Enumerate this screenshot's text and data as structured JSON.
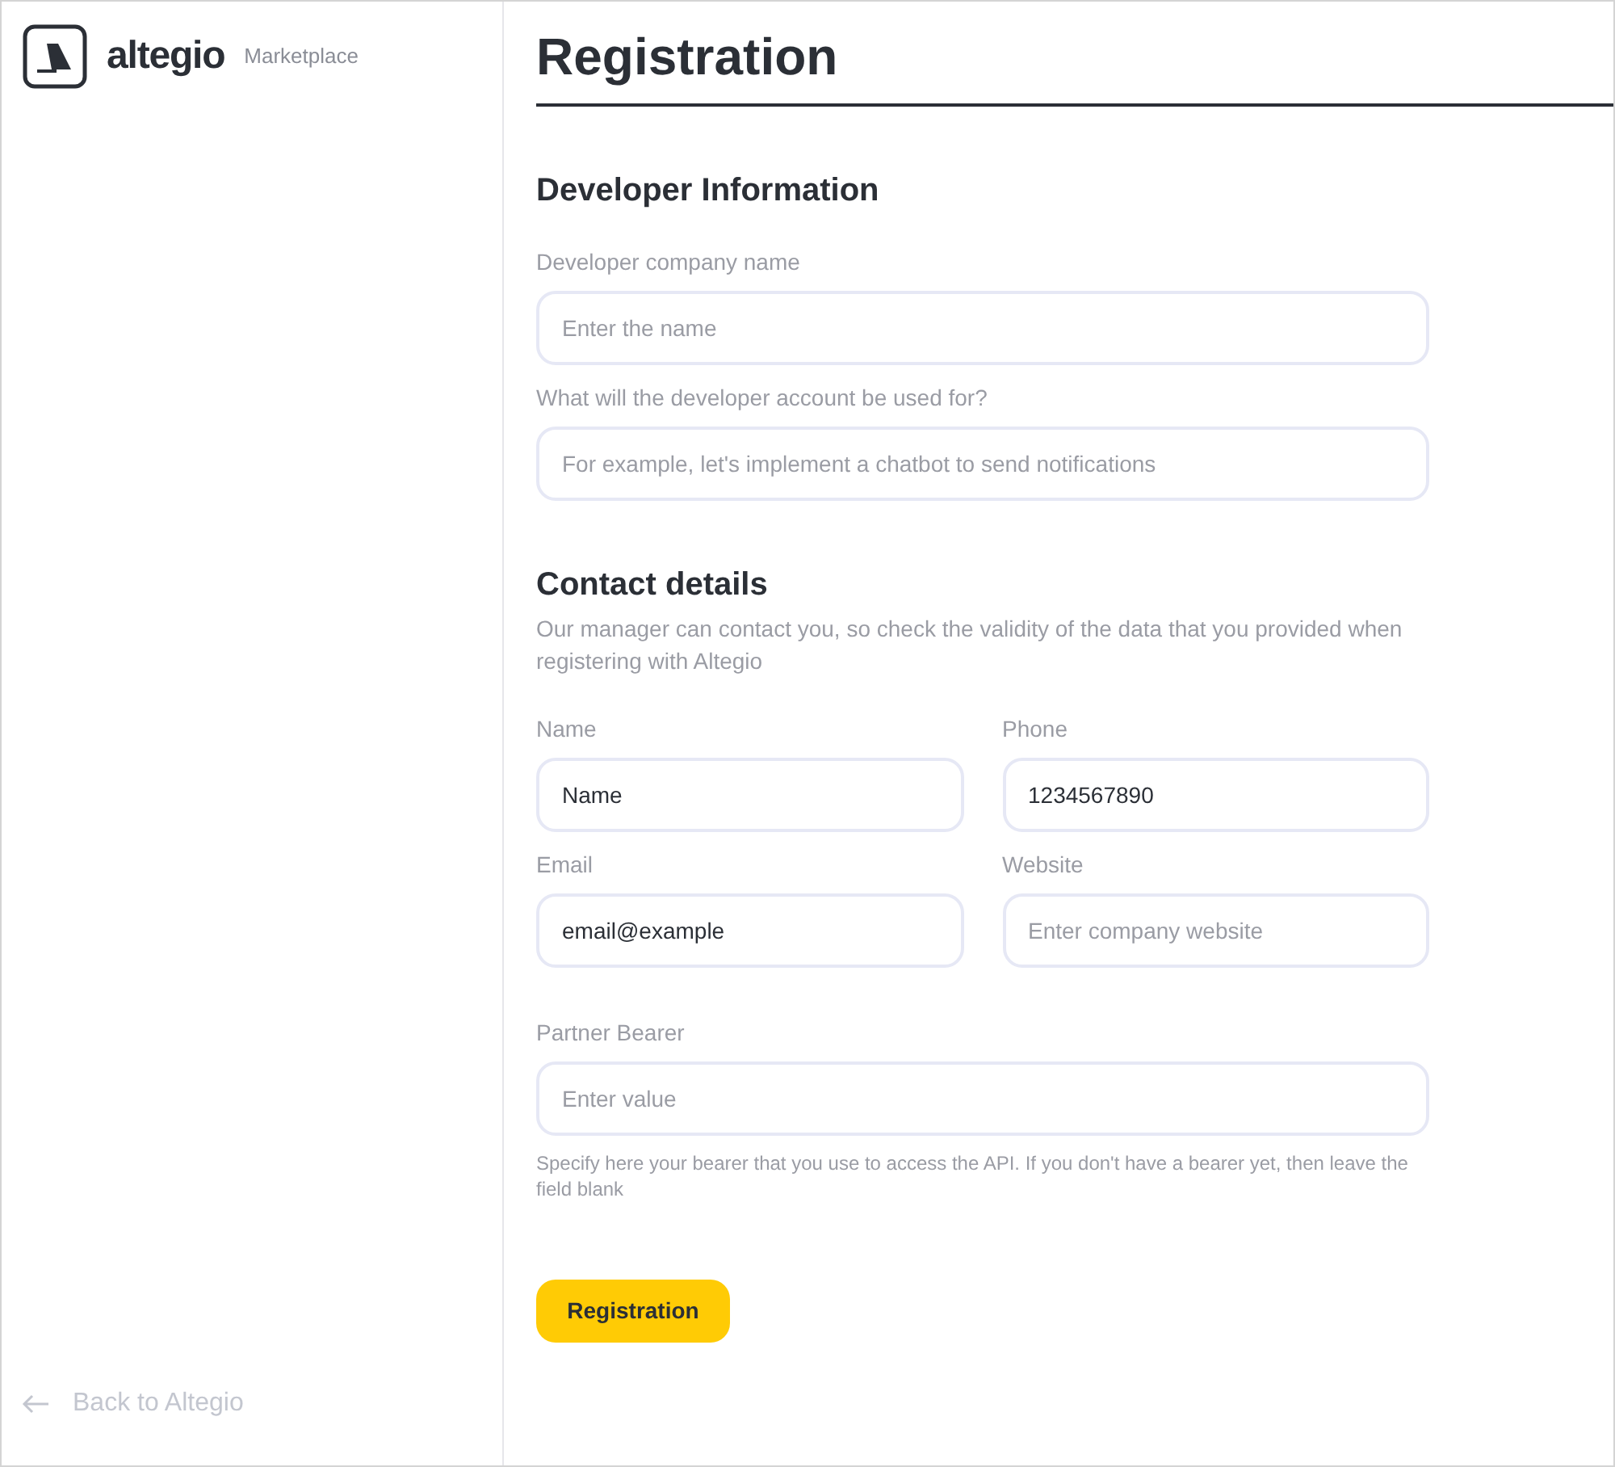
{
  "sidebar": {
    "brand": "altegio",
    "subtitle": "Marketplace",
    "back_link": "Back to Altegio"
  },
  "page_title": "Registration",
  "sections": [
    {
      "heading": "Developer Information",
      "rows": [
        [
          {
            "label": "Developer company name",
            "placeholder": "Enter the name"
          }
        ],
        [
          {
            "label": "What will the developer account be used for?",
            "placeholder": "For example, let's implement a chatbot to send notifications"
          }
        ]
      ]
    },
    {
      "heading": "Contact details",
      "description": "Our manager can contact you, so check the validity of the data that you provided when registering with Altegio",
      "rows": [
        [
          {
            "label": "Name",
            "value": "Name"
          },
          {
            "label": "Phone",
            "value": "1234567890"
          }
        ],
        [
          {
            "label": "Email",
            "value": "email@example"
          },
          {
            "label": "Website",
            "placeholder": "Enter company website"
          }
        ],
        [
          {
            "label": "Partner Bearer",
            "placeholder": "Enter value",
            "hint": "Specify here your bearer that you use to access the API. If you don't have a bearer yet, then leave the field blank"
          }
        ]
      ]
    }
  ],
  "submit_button": "Registration"
}
